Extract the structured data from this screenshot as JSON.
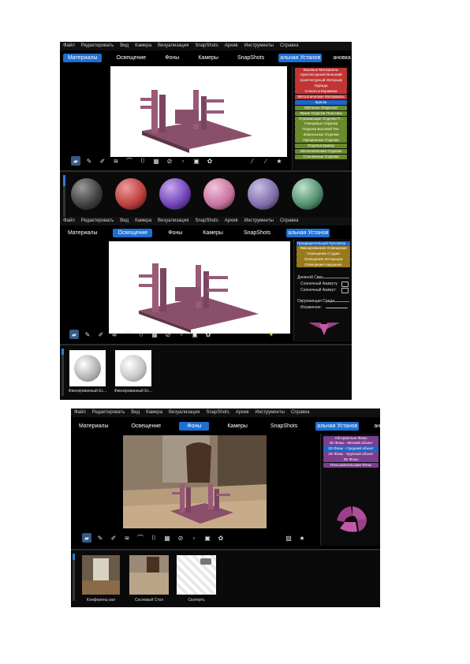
{
  "shots": [
    {
      "menu": [
        "Файл",
        "Редактировать",
        "Вид",
        "Камера",
        "Визуализация",
        "SnapShots",
        "Архив",
        "Инструменты",
        "Справка"
      ],
      "tabs": [
        "Материалы",
        "Освещение",
        "Фоны",
        "Камеры",
        "SnapShots",
        "альная Установ",
        "ановка Пользова"
      ],
      "active_tab": 0,
      "materials": [
        {
          "label": "Базовые Материалы",
          "color": "#c23535"
        },
        {
          "label": "Архитектурный Внешний",
          "color": "#c23535"
        },
        {
          "label": "Архитектурный Интерьер",
          "color": "#c23535"
        },
        {
          "label": "Одежда",
          "color": "#c23535"
        },
        {
          "label": "Стекло и Керамика",
          "color": "#c23535"
        },
        {
          "label": "Металлические Материалы",
          "color": "#c23535"
        },
        {
          "label": "Краски",
          "color": "#1f66cc"
        },
        {
          "label": "Матовые Покрытия",
          "color": "#6b8a2a"
        },
        {
          "label": "Яркие Отделки Пластика",
          "color": "#6b8a2a"
        },
        {
          "label": "Отражающие Отделки П...",
          "color": "#6b8a2a"
        },
        {
          "label": "Глянцевые Отделки",
          "color": "#6b8a2a"
        },
        {
          "label": "Отделка Бытовой Тех.",
          "color": "#6b8a2a"
        },
        {
          "label": "Зеркальные Отделки",
          "color": "#6b8a2a"
        },
        {
          "label": "Прозрачные Отделки",
          "color": "#6b8a2a"
        },
        {
          "label": "Отделка Краски",
          "color": "#6b8a2a"
        },
        {
          "label": "Металлические Отделки",
          "color": "#6b8a2a"
        },
        {
          "label": "Стеклянные Отделки",
          "color": "#6b8a2a"
        }
      ],
      "spheres": [
        {
          "color": "#3c3c3c",
          "hl": "#9a9a9a"
        },
        {
          "color": "#b83a3a",
          "hl": "#ef9a9a"
        },
        {
          "color": "#6c3fb5",
          "hl": "#c7a8f0"
        },
        {
          "color": "#c56f9c",
          "hl": "#f2c3dc"
        },
        {
          "color": "#7d6aa8",
          "hl": "#cbbfe6"
        },
        {
          "color": "#4d8a6a",
          "hl": "#bfe2cf"
        }
      ]
    },
    {
      "menu": [
        "Файл",
        "Редактировать",
        "Вид",
        "Камера",
        "Визуализация",
        "SnapShots",
        "Архив",
        "Инструменты",
        "Справка"
      ],
      "tabs": [
        "Материалы",
        "Освещение",
        "Фоны",
        "Камеры",
        "SnapShots",
        "альная Установ"
      ],
      "active_tab": 1,
      "lighting_presets": [
        {
          "label": "Предварительный Просмотр ...",
          "color": "#1f66cc"
        },
        {
          "label": "Фиксированное Освещение",
          "color": "#9a7a18"
        },
        {
          "label": "Освещение Студии",
          "color": "#9a7a18"
        },
        {
          "label": "Освещение Интерьера",
          "color": "#9a7a18"
        },
        {
          "label": "Освещение Наружное",
          "color": "#9a7a18"
        }
      ],
      "settings": {
        "light_label": "Дневной Свет",
        "ambient_label": "Солнечный Азимуту",
        "azimuth_label": "Солнечный Азимут:",
        "env_label": "Окружающая Среда",
        "distortion_label": "Искажение:"
      },
      "thumbs": [
        "Фиксированный Ес...",
        "Фиксированный Ес..."
      ]
    },
    {
      "menu": [
        "Файл",
        "Редактировать",
        "Вид",
        "Камера",
        "Визуализация",
        "SnapShots",
        "Архив",
        "Инструменты",
        "Справка"
      ],
      "tabs": [
        "Материалы",
        "Освещение",
        "Фоны",
        "Камеры",
        "SnapShots",
        "альная Установ",
        "ановка Пользова"
      ],
      "active_tab": 2,
      "backgrounds": [
        {
          "label": "Абстрактные Фоны",
          "color": "#7a3f8e"
        },
        {
          "label": "2D Фоны - Мелкий объект",
          "color": "#7a3f8e"
        },
        {
          "label": "2D Фоны - Средний объект",
          "color": "#1f66cc"
        },
        {
          "label": "2D Фоны - Крупный объект",
          "color": "#7a3f8e"
        },
        {
          "label": "3D Фоны",
          "color": "#7a3f8e"
        },
        {
          "label": "Пользовательские Фоны",
          "color": "#7a3f8e"
        }
      ],
      "thumbs": [
        "Конференц-зал",
        "Сосновый Стол",
        "Скатерть"
      ]
    }
  ]
}
